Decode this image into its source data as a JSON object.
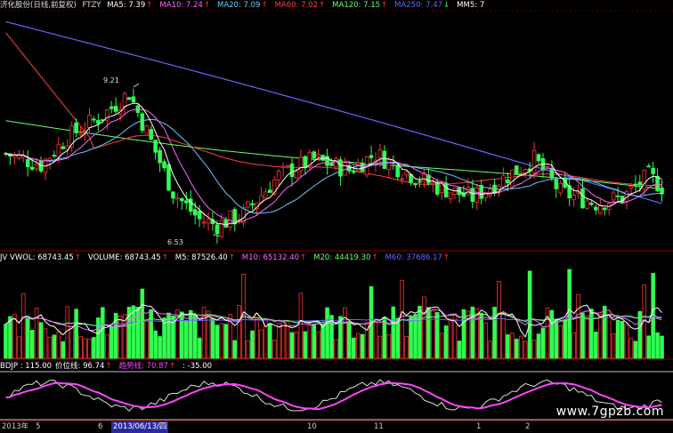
{
  "main_panel": {
    "title": "济化股份(日线,前复权)",
    "indicator": "FTZY",
    "mas": [
      {
        "label": "MA5:",
        "value": "7.39",
        "color": "#ffffff",
        "arrow": "up"
      },
      {
        "label": "MA10:",
        "value": "7.24",
        "color": "#ff66ff",
        "arrow": "up"
      },
      {
        "label": "MA20:",
        "value": "7.09",
        "color": "#66ccff",
        "arrow": "up"
      },
      {
        "label": "MA60:",
        "value": "7.02",
        "color": "#ff4040",
        "arrow": "up"
      },
      {
        "label": "MA120:",
        "value": "7.15",
        "color": "#66ff66",
        "arrow": "up"
      },
      {
        "label": "MA250:",
        "value": "7.47",
        "color": "#6666ff",
        "arrow": "down"
      },
      {
        "label": "MM5:",
        "value": "7",
        "color": "#ffffff",
        "arrow": ""
      }
    ],
    "high_label": "9.21",
    "low_label": "6.53"
  },
  "volume_panel": {
    "items": [
      {
        "label": "JV VWOL:",
        "value": "68743.45",
        "color": "#ffffff",
        "arrow": "up"
      },
      {
        "label": "VOLUME:",
        "value": "68743.45",
        "color": "#ffffff",
        "arrow": "up"
      },
      {
        "label": "M5:",
        "value": "87526.40",
        "color": "#ffffff",
        "arrow": "up"
      },
      {
        "label": "M10:",
        "value": "65132.40",
        "color": "#ff66ff",
        "arrow": "up"
      },
      {
        "label": "M20:",
        "value": "44419.30",
        "color": "#66ff66",
        "arrow": "up"
      },
      {
        "label": "M60:",
        "value": "37686.17",
        "color": "#6666ff",
        "arrow": "up"
      }
    ]
  },
  "bdjp_panel": {
    "items": [
      {
        "label": "BDJP :",
        "value": "115.00",
        "color": "#ffffff",
        "arrow": ""
      },
      {
        "label": "价位线:",
        "value": "96.74",
        "color": "#ffffff",
        "arrow": "up"
      },
      {
        "label": "趋势线:",
        "value": "70.87",
        "color": "#ff44ff",
        "arrow": "up"
      },
      {
        "label": ":",
        "value": "-35.00",
        "color": "#ffffff",
        "arrow": ""
      }
    ]
  },
  "date_axis": {
    "labels": [
      "2013年",
      "5",
      "6",
      "10",
      "11",
      "1",
      "2"
    ],
    "selected_date": "2013/06/13/四"
  },
  "watermark": "www.7gpzb.com",
  "chart_data": {
    "type": "candlestick",
    "ma_colors": {
      "ma5": "#ffffff",
      "ma10": "#ff66ff",
      "ma20": "#66ccff",
      "ma60": "#ff4040",
      "ma120": "#66ff66",
      "ma250": "#6666ff"
    },
    "up_color": "#ff3030",
    "down_color": "#30ff50",
    "price_range": [
      6.3,
      10.6
    ],
    "marked_high": 9.21,
    "marked_low": 6.53
  }
}
